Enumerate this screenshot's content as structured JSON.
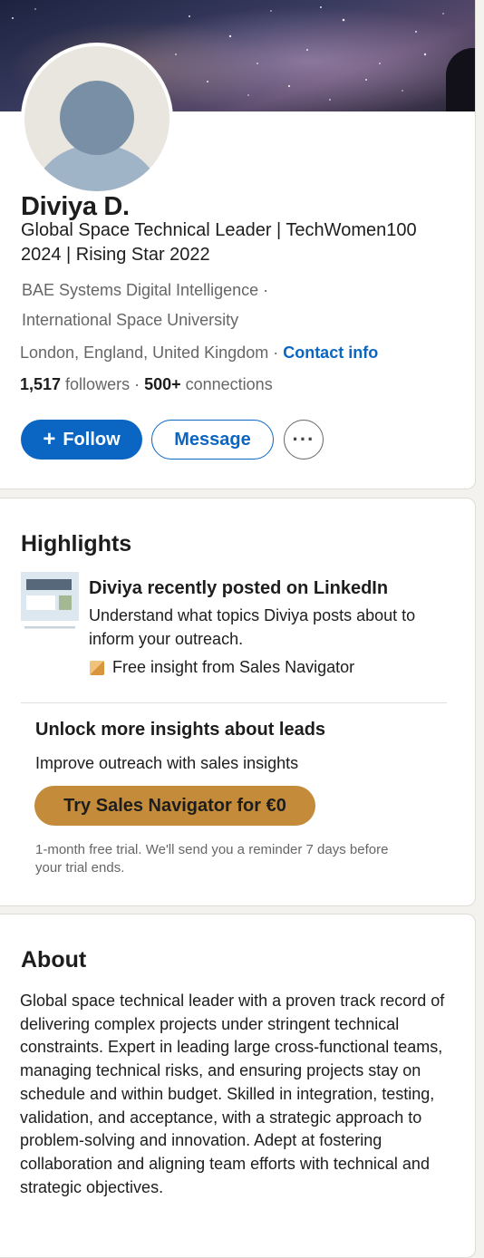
{
  "profile": {
    "name": "Diviya D.",
    "headline": "Global Space Technical Leader | TechWomen100 2024 | Rising Star 2022",
    "company": "BAE Systems Digital Intelligence",
    "company_sep": " ·",
    "school": "International Space University",
    "location": "London, England, United Kingdom",
    "location_sep": " · ",
    "contact_info_label": "Contact info",
    "followers_count": "1,517",
    "followers_label": " followers",
    "dot": " · ",
    "connections_count": "500+",
    "connections_label": " connections",
    "avatar_icon": "default-avatar-silhouette"
  },
  "actions": {
    "follow_label": "Follow",
    "follow_icon": "+",
    "message_label": "Message",
    "more_label": "···"
  },
  "highlights": {
    "title": "Highlights",
    "item_title": "Diviya recently posted on LinkedIn",
    "item_desc": "Understand what topics Diviya posts about to inform your outreach.",
    "badge_label": "Free insight from Sales Navigator",
    "badge_icon": "sales-navigator-icon",
    "unlock_title": "Unlock more insights about leads",
    "unlock_sub": "Improve outreach with sales insights",
    "sales_button_label": "Try Sales Navigator for €0",
    "trial_note": "1-month free trial. We'll send you a reminder 7 days before your trial ends."
  },
  "about": {
    "title": "About",
    "text": "Global space technical leader with a proven track record of delivering complex projects under stringent technical constraints. Expert in leading large cross-functional teams, managing technical risks, and ensuring projects stay on schedule and within budget. Skilled in integration, testing, validation, and acceptance, with a strategic approach to problem-solving and innovation. Adept at fostering collaboration and aligning team efforts with technical and strategic objectives."
  },
  "colors": {
    "accent": "#0a66c2",
    "sales_gold": "#c38b3a",
    "secondary_text": "#666666"
  }
}
